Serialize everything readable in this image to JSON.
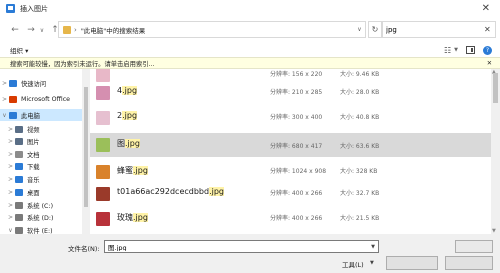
{
  "window": {
    "title": "插入图片",
    "close_label": "✕"
  },
  "nav": {
    "back": "←",
    "forward": "→",
    "up": "↑",
    "address_path": "\"此电脑\"中的搜索结果",
    "search_value": "jpg"
  },
  "command_bar": {
    "organize_label": "组织 ▾"
  },
  "info_bar": {
    "message": "搜索可能较慢，因为索引未运行。请单击启用索引..."
  },
  "sidebar": {
    "items": [
      {
        "label": "快速访问",
        "icon": "star-icon",
        "color": "#2b7bd6",
        "expand": ">"
      },
      {
        "label": "Microsoft Office",
        "icon": "office-icon",
        "color": "#d83b01",
        "expand": ">"
      },
      {
        "label": "此电脑",
        "icon": "computer-icon",
        "color": "#2b7bd6",
        "expand": "∨",
        "selected": true
      },
      {
        "label": "视频",
        "icon": "video-folder-icon",
        "color": "#5a6e86",
        "expand": ">"
      },
      {
        "label": "图片",
        "icon": "pictures-folder-icon",
        "color": "#5a6e86",
        "expand": ">"
      },
      {
        "label": "文档",
        "icon": "documents-folder-icon",
        "color": "#8c8c8c",
        "expand": ">"
      },
      {
        "label": "下载",
        "icon": "download-icon",
        "color": "#2b7bd6",
        "expand": ">"
      },
      {
        "label": "音乐",
        "icon": "music-icon",
        "color": "#2b7bd6",
        "expand": ">"
      },
      {
        "label": "桌面",
        "icon": "desktop-icon",
        "color": "#2b7bd6",
        "expand": ">"
      },
      {
        "label": "系统 (C:)",
        "icon": "drive-icon",
        "color": "#7a7a7a",
        "expand": ">"
      },
      {
        "label": "系统 (D:)",
        "icon": "drive-icon",
        "color": "#7a7a7a",
        "expand": ">"
      },
      {
        "label": "软件 (E:)",
        "icon": "drive-icon",
        "color": "#7a7a7a",
        "expand": "∨"
      }
    ]
  },
  "files": [
    {
      "name": "",
      "highlight": "",
      "dim": "分辨率: 156 x 220",
      "size": "大小: 9.46 KB",
      "thumb": "#e8b8c8"
    },
    {
      "name": "4",
      "highlight": ".jpg",
      "dim": "分辨率: 210 x 285",
      "size": "大小: 28.0 KB",
      "thumb": "#d58fb0"
    },
    {
      "name": "2",
      "highlight": ".jpg",
      "dim": "分辨率: 300 x 400",
      "size": "大小: 40.8 KB",
      "thumb": "#e6c0d0"
    },
    {
      "name": "图",
      "highlight": ".jpg",
      "dim": "分辨率: 680 x 417",
      "size": "大小: 63.6 KB",
      "thumb": "#9bbf5a",
      "selected": true
    },
    {
      "name": "蜂蜜",
      "highlight": ".jpg",
      "dim": "分辨率: 1024 x 908",
      "size": "大小: 328 KB",
      "thumb": "#d9822b"
    },
    {
      "name": "t01a66ac292dcecdbbd",
      "highlight": ".jpg",
      "dim": "分辨率: 400 x 266",
      "size": "大小: 32.7 KB",
      "thumb": "#9a3a2a"
    },
    {
      "name": "玫瑰",
      "highlight": ".jpg",
      "dim": "分辨率: 400 x 266",
      "size": "大小: 21.5 KB",
      "thumb": "#b8323a"
    }
  ],
  "bottom": {
    "filename_label": "文件名(N):",
    "filename_value": "图.jpg",
    "tools_label": "工具(L)",
    "insert_label": "",
    "cancel_label": ""
  }
}
